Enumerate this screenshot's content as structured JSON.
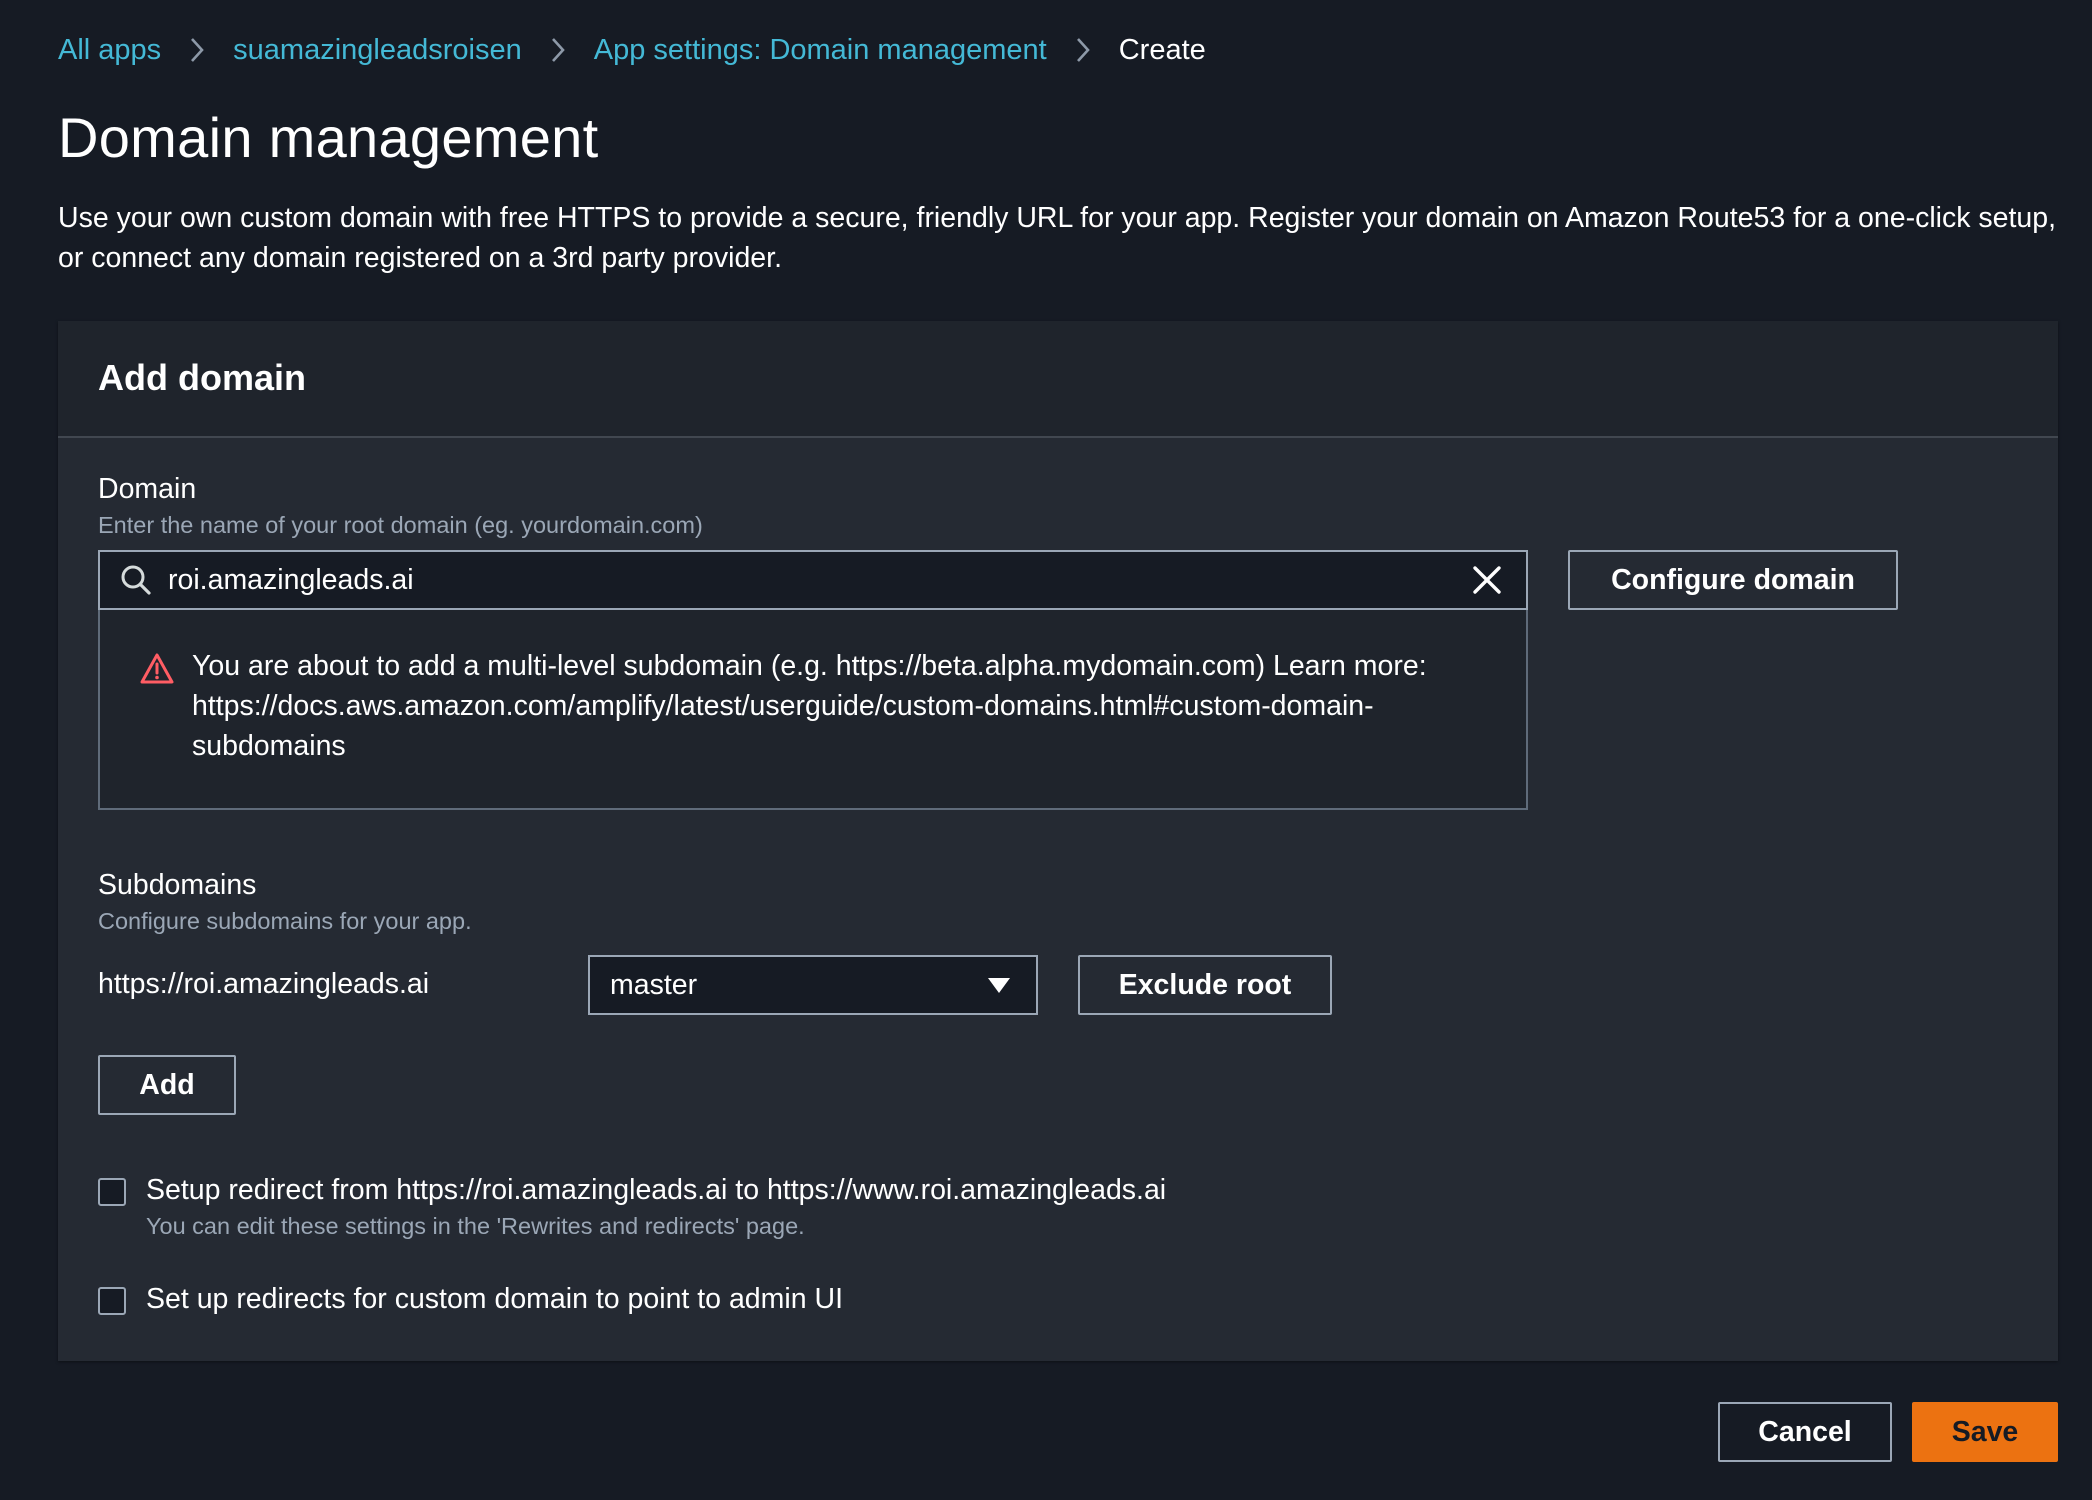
{
  "breadcrumb": {
    "items": [
      "All apps",
      "suamazingleadsroisen",
      "App settings: Domain management"
    ],
    "current": "Create"
  },
  "page": {
    "title": "Domain management",
    "description": "Use your own custom domain with free HTTPS to provide a secure, friendly URL for your app. Register your domain on Amazon Route53 for a one-click setup, or connect any domain registered on a 3rd party provider."
  },
  "panel": {
    "title": "Add domain"
  },
  "domain": {
    "label": "Domain",
    "hint": "Enter the name of your root domain (eg. yourdomain.com)",
    "value": "roi.amazingleads.ai",
    "configure_label": "Configure domain",
    "warning": "You are about to add a multi-level subdomain (e.g. https://beta.alpha.mydomain.com) Learn more: https://docs.aws.amazon.com/amplify/latest/userguide/custom-domains.html#custom-domain-subdomains"
  },
  "subdomains": {
    "label": "Subdomains",
    "hint": "Configure subdomains for your app.",
    "url": "https://roi.amazingleads.ai",
    "branch": "master",
    "exclude_label": "Exclude root",
    "add_label": "Add"
  },
  "options": {
    "redirect_label": "Setup redirect from https://roi.amazingleads.ai to https://www.roi.amazingleads.ai",
    "redirect_hint": "You can edit these settings in the 'Rewrites and redirects' page.",
    "redirect_checked": false,
    "admin_label": "Set up redirects for custom domain to point to admin UI",
    "admin_checked": false
  },
  "footer": {
    "cancel_label": "Cancel",
    "save_label": "Save"
  },
  "colors": {
    "background": "#161b24",
    "panel": "#252a33",
    "link": "#44b9d6",
    "primary": "#ec7211",
    "warning": "#ff5d64"
  }
}
